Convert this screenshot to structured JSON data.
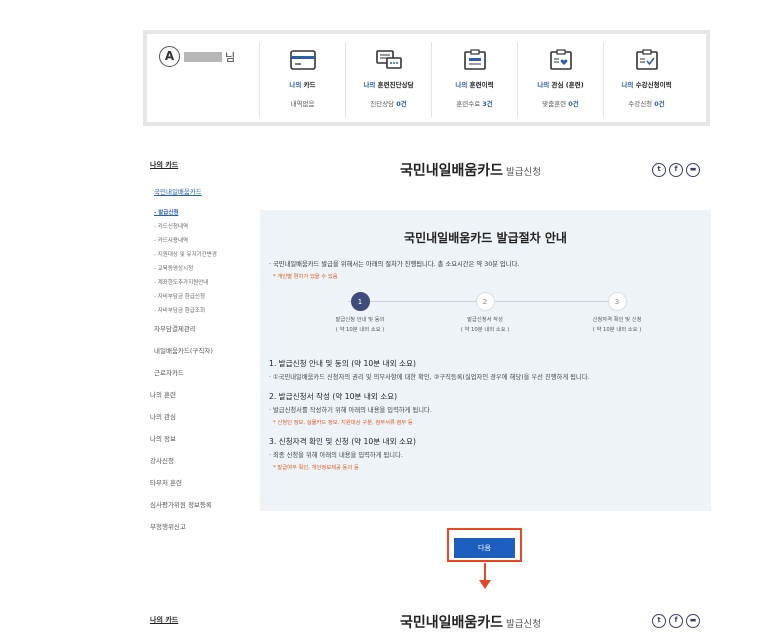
{
  "user": {
    "avatar_letter": "A",
    "suffix": "님"
  },
  "menu": [
    {
      "icon": "card-icon",
      "label_blue": "나의",
      "label": " 카드",
      "value_text": "내역없음",
      "value_num": ""
    },
    {
      "icon": "consult-chat-icon",
      "label_blue": "나의",
      "label": " 훈련진단상담",
      "value_text": "진단상담 ",
      "value_num": "0건"
    },
    {
      "icon": "training-history-icon",
      "label_blue": "나의",
      "label": " 훈련이력",
      "value_text": "훈련수료 ",
      "value_num": "3건"
    },
    {
      "icon": "interest-heart-icon",
      "label_blue": "나의",
      "label": " 관심 (훈련)",
      "value_text": "맞춤훈련 ",
      "value_num": "0건"
    },
    {
      "icon": "application-check-icon",
      "label_blue": "나의",
      "label": " 수강신청이력",
      "value_text": "수강신청 ",
      "value_num": "0건"
    }
  ],
  "sidebar": {
    "title": "나의 카드",
    "sub": "국민내일배움카드",
    "items": [
      "- 발급신청",
      "- 카드신청내역",
      "- 카드사용내역",
      "- 지원대상 및 유지기간변경",
      "- 교육동영상시청",
      "- 계좌한도추가지원안내",
      "- 자비부담금 환급신청",
      "- 자비부담금 환급조회"
    ],
    "main_items": [
      "자부담결제관리",
      "내일배움카드(구직자)",
      "근로자카드",
      "나의 훈련",
      "나의 관심",
      "나의 정보",
      "강사신청",
      "타부처 훈련",
      "심사평가위원 정보등록",
      "부정행위신고"
    ]
  },
  "page": {
    "title": "국민내일배움카드",
    "title_suffix": "발급신청"
  },
  "share": {
    "twitter": "t",
    "facebook": "f",
    "other": "▬"
  },
  "panel": {
    "heading": "국민내일배움카드 발급절차 안내",
    "intro": "· 국민내일배움카드 발급을 위해서는 아래의 절차가 진행됩니다. 총 소요시간은 약 30분 입니다.",
    "note": "* 개인별 편차가 있을 수 있음",
    "steps": [
      {
        "num": "1",
        "title": "발급신청 안내 및 동의",
        "duration": "( 약 10분 내외 소요 )"
      },
      {
        "num": "2",
        "title": "발급신청서 작성",
        "duration": "( 약 10분 내외 소요 )"
      },
      {
        "num": "3",
        "title": "신청자격 확인 및 신청",
        "duration": "( 약 10분 내외 소요 )"
      }
    ],
    "sections": [
      {
        "heading": "1. 발급신청 안내 및 동의 (약 10분 내외 소요)",
        "desc": "· ①국민내일배움카드 신청자의 권리 및 의무사항에 대한 확인, ②구직등록(실업자인 경우에 해당)을 우선 진행하게 됩니다.",
        "req": ""
      },
      {
        "heading": "2. 발급신청서 작성 (약 10분 내외 소요)",
        "desc": "· 발급신청서를 작성하기 위해 아래의 내용을 입력하게 됩니다.",
        "req": "* 신청인 정보, 실물카드 정보, 지원대상 구분, 첨부서류 첨부 등"
      },
      {
        "heading": "3. 신청자격 확인 및 신청 (약 10분 내외 소요)",
        "desc": "· 최종 신청을 위해 아래의 내용을 입력하게 됩니다.",
        "req": "* 발급여부 확인, 개인정보제공 동의 등"
      }
    ]
  },
  "next_button": "다음",
  "bottom": {
    "side_title": "나의 카드",
    "title": "국민내일배움카드",
    "title_suffix": "발급신청"
  },
  "colors": {
    "accent": "#1c5fbf",
    "highlight": "#e8471f",
    "panel_bg": "#eef3f8",
    "step_active": "#3d4c7a"
  }
}
